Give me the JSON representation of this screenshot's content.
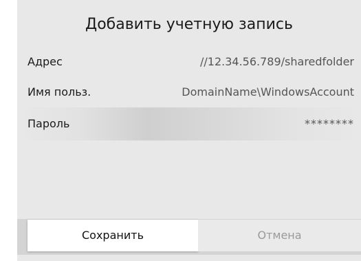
{
  "dialog": {
    "title": "Добавить учетную запись",
    "fields": {
      "address": {
        "label": "Адрес",
        "value": "//12.34.56.789/sharedfolder"
      },
      "username": {
        "label": "Имя польз.",
        "value": "DomainName\\WindowsAccount"
      },
      "password": {
        "label": "Пароль",
        "value": "********"
      }
    },
    "buttons": {
      "save": "Сохранить",
      "cancel": "Отмена"
    }
  }
}
